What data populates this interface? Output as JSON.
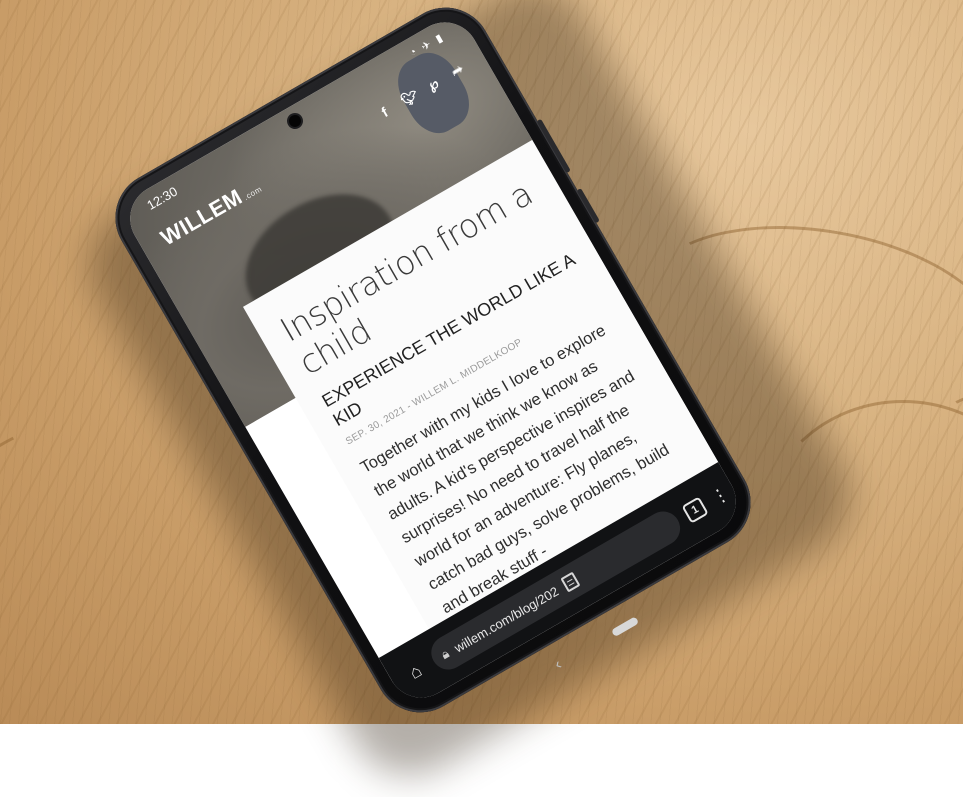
{
  "status_bar": {
    "time": "12:30",
    "icons": [
      "wifi-icon",
      "airplane-icon",
      "battery-icon"
    ]
  },
  "site": {
    "logo": "WILLEM",
    "logo_suffix": ".com",
    "share_icons": [
      "facebook-icon",
      "twitter-icon",
      "pinterest-icon",
      "share-icon"
    ]
  },
  "article": {
    "title": "Inspiration from a child",
    "subtitle": "EXPERIENCE THE WORLD LIKE A KID",
    "byline": "SEP. 30, 2021 - WILLEM L. MIDDELKOOP",
    "body": "Together with my kids I love to explore the world that we think we know as adults. A kid's perspective inspires and surprises! No need to travel half the world for an adventure: Fly planes, catch bad guys, solve problems, build and break stuff -"
  },
  "browser": {
    "url": "willem.com/blog/202",
    "tab_count": "1"
  },
  "colors": {
    "wood": "#d6b07f",
    "phone": "#111113",
    "card": "#fbfbfb",
    "toolbar": "#111214"
  }
}
